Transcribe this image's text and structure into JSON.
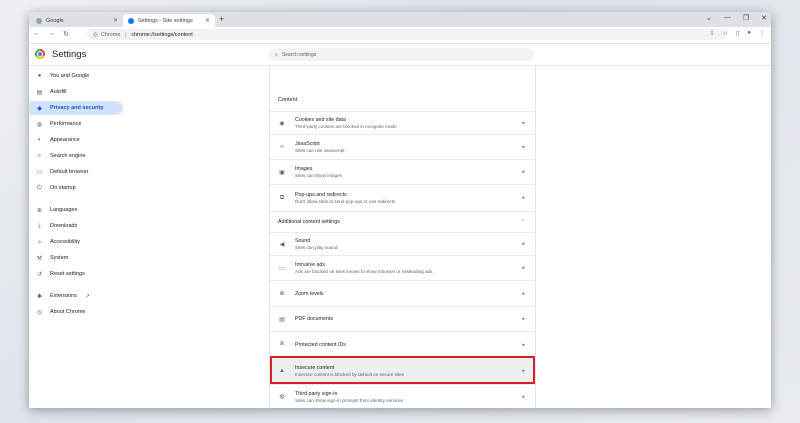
{
  "tabs": [
    {
      "label": "Google",
      "active": false
    },
    {
      "label": "Settings - Site settings",
      "active": true
    }
  ],
  "window_controls": [
    "⌄",
    "—",
    "❐",
    "✕"
  ],
  "address_bar": {
    "chip_label": "Chrome",
    "url": "chrome://settings/content"
  },
  "settings_header": {
    "title": "Settings",
    "search_placeholder": "Search settings"
  },
  "sidebar": {
    "items": [
      {
        "label": "You and Google",
        "icon": "person-icon",
        "glyph": "●"
      },
      {
        "label": "Autofill",
        "icon": "autofill-icon",
        "glyph": "▤"
      },
      {
        "label": "Privacy and security",
        "icon": "shield-icon",
        "glyph": "◈",
        "active": true
      },
      {
        "label": "Performance",
        "icon": "performance-icon",
        "glyph": "◍"
      },
      {
        "label": "Appearance",
        "icon": "palette-icon",
        "glyph": "◐"
      },
      {
        "label": "Search engine",
        "icon": "search-icon",
        "glyph": "⌕"
      },
      {
        "label": "Default browser",
        "icon": "browser-icon",
        "glyph": "▭"
      },
      {
        "label": "On startup",
        "icon": "power-icon",
        "glyph": "⏻"
      },
      {
        "label": "Languages",
        "icon": "globe-icon",
        "glyph": "⊕"
      },
      {
        "label": "Downloads",
        "icon": "download-icon",
        "glyph": "⤓"
      },
      {
        "label": "Accessibility",
        "icon": "accessibility-icon",
        "glyph": "✧"
      },
      {
        "label": "System",
        "icon": "wrench-icon",
        "glyph": "⚒"
      },
      {
        "label": "Reset settings",
        "icon": "reset-icon",
        "glyph": "↺"
      },
      {
        "label": "Extensions",
        "icon": "puzzle-icon",
        "glyph": "✱",
        "external_icon": "↗"
      },
      {
        "label": "About Chrome",
        "icon": "chrome-icon",
        "glyph": "◎"
      }
    ]
  },
  "content": {
    "section_title": "Content",
    "rows": [
      {
        "title": "Cookies and site data",
        "subtitle": "Third-party cookies are blocked in Incognito mode",
        "icon": "cookie-icon",
        "glyph": "◉"
      },
      {
        "title": "JavaScript",
        "subtitle": "Sites can use Javascript",
        "icon": "code-icon",
        "glyph": "‹›"
      },
      {
        "title": "Images",
        "subtitle": "Sites can show images",
        "icon": "image-icon",
        "glyph": "▣"
      },
      {
        "title": "Pop-ups and redirects",
        "subtitle": "Don't allow sites to send pop-ups or use redirects",
        "icon": "popup-icon",
        "glyph": "⧉"
      }
    ],
    "additional_title": "Additional content settings",
    "additional_rows": [
      {
        "title": "Sound",
        "subtitle": "Sites can play sound",
        "icon": "sound-icon",
        "glyph": "◀"
      },
      {
        "title": "Intrusive ads",
        "subtitle": "Ads are blocked on sites known to show intrusive or misleading ads",
        "icon": "ads-icon",
        "glyph": "▭"
      },
      {
        "title": "Zoom levels",
        "subtitle": "",
        "icon": "zoom-icon",
        "glyph": "⊕"
      },
      {
        "title": "PDF documents",
        "subtitle": "",
        "icon": "pdf-icon",
        "glyph": "▤"
      },
      {
        "title": "Protected content IDs",
        "subtitle": "",
        "icon": "protected-icon",
        "glyph": "⧈"
      },
      {
        "title": "Insecure content",
        "subtitle": "Insecure content is blocked by default on secure sites",
        "icon": "warning-icon",
        "glyph": "▲"
      },
      {
        "title": "Third party sign-in",
        "subtitle": "Sites can show sign-in prompts from identity services",
        "icon": "account-icon",
        "glyph": "◍"
      }
    ]
  },
  "colors": {
    "highlight": "#d9202a",
    "accent": "#0b57d0",
    "active_bg": "#d3e3fd"
  }
}
